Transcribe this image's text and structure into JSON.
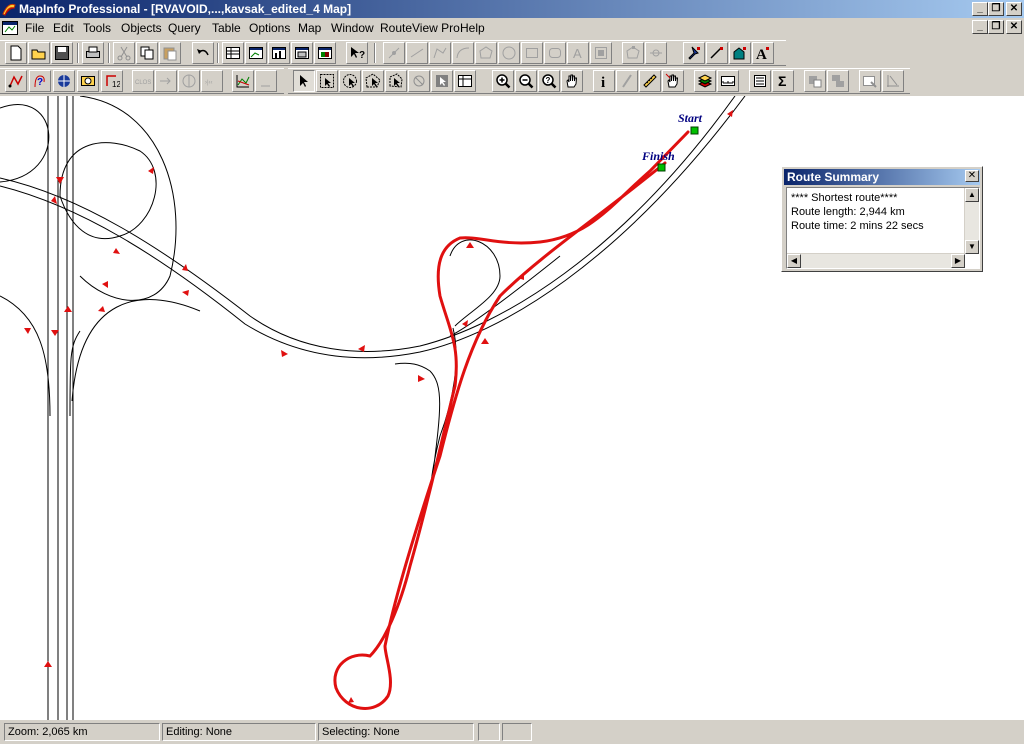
{
  "window": {
    "title": "MapInfo Professional - [RVAVOID,...,kavsak_edited_4 Map]"
  },
  "menu": [
    "File",
    "Edit",
    "Tools",
    "Objects",
    "Query",
    "Table",
    "Options",
    "Map",
    "Window",
    "RouteView Pro",
    "Help"
  ],
  "map": {
    "start_label": "Start",
    "finish_label": "Finish",
    "route_color": "#e01010",
    "road_color": "#000000"
  },
  "route_summary": {
    "title": "Route Summary",
    "lines": [
      "**** Shortest route****",
      "Route length: 2,944 km",
      "Route time: 2 mins 22 secs"
    ]
  },
  "status": {
    "zoom": "Zoom: 2,065 km",
    "editing": "Editing: None",
    "selecting": "Selecting: None"
  },
  "colors": {
    "title_bar": "#0a246a",
    "chrome": "#d4d0c8"
  }
}
